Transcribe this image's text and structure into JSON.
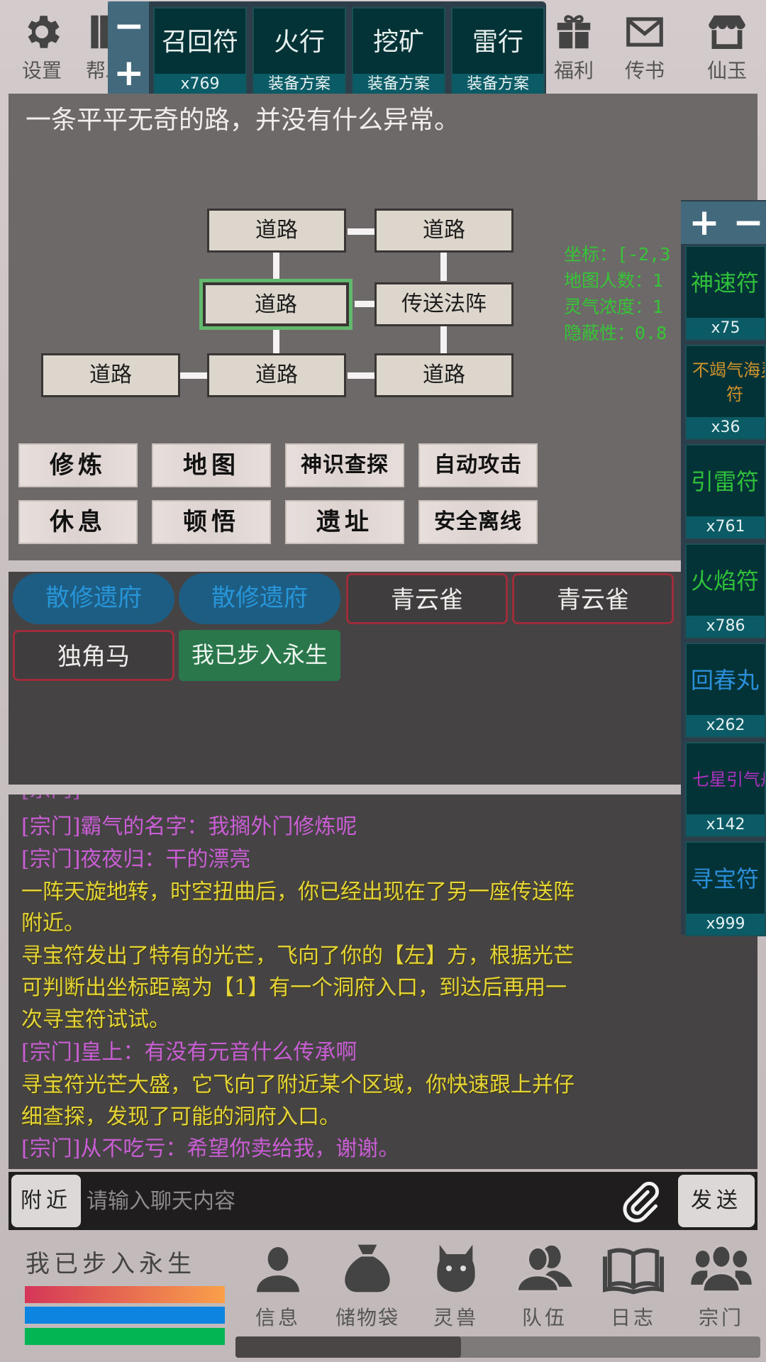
{
  "top_icons": {
    "settings": "设置",
    "help": "帮助",
    "welfare": "福利",
    "mail": "传书",
    "shop": "仙玉"
  },
  "top_quickslots": {
    "zoom_out": "−",
    "zoom_in": "+",
    "slots": [
      {
        "name": "召回符",
        "sub": "x769"
      },
      {
        "name": "火行",
        "sub": "装备方案"
      },
      {
        "name": "挖矿",
        "sub": "装备方案"
      },
      {
        "name": "雷行",
        "sub": "装备方案"
      }
    ]
  },
  "location": {
    "description": "一条平平无奇的路，并没有什么异常。",
    "map_nodes": [
      {
        "id": "n1",
        "label": "道路"
      },
      {
        "id": "n2",
        "label": "道路"
      },
      {
        "id": "n3",
        "label": "道路",
        "current": true
      },
      {
        "id": "n4",
        "label": "传送法阵"
      },
      {
        "id": "n5",
        "label": "道路"
      },
      {
        "id": "n6",
        "label": "道路"
      },
      {
        "id": "n7",
        "label": "道路"
      }
    ],
    "info": {
      "coords": "坐标：[-2,3",
      "map_players": "地图人数：1",
      "spirit_density": "灵气浓度：1",
      "concealment": "隐蔽性：0.8"
    },
    "highlight_color": "#62b86c",
    "info_color": "#36c536"
  },
  "actions": [
    "修炼",
    "地图",
    "神识查探",
    "自动攻击",
    "休息",
    "顿悟",
    "遗址",
    "安全离线"
  ],
  "entities": [
    {
      "label": "散修遗府",
      "type": "blue"
    },
    {
      "label": "散修遗府",
      "type": "blue"
    },
    {
      "label": "青云雀",
      "type": "red"
    },
    {
      "label": "青云雀",
      "type": "red"
    },
    {
      "label": "独角马",
      "type": "red"
    },
    {
      "label": "我已步入永生",
      "type": "green"
    }
  ],
  "chat": {
    "messages": [
      {
        "type": "sect",
        "text": "[宗门]霸气的名字：我搁外门修炼呢"
      },
      {
        "type": "sect",
        "text": "[宗门]夜夜归：干的漂亮"
      },
      {
        "type": "sys",
        "text": "一阵天旋地转，时空扭曲后，你已经出现在了另一座传送阵"
      },
      {
        "type": "sys",
        "text": "附近。"
      },
      {
        "type": "sys",
        "text": "寻宝符发出了特有的光芒，飞向了你的【左】方，根据光芒"
      },
      {
        "type": "sys",
        "text": "可判断出坐标距离为【1】有一个洞府入口，到达后再用一"
      },
      {
        "type": "sys",
        "text": "次寻宝符试试。"
      },
      {
        "type": "sect",
        "text": "[宗门]皇上：有没有元音什么传承啊"
      },
      {
        "type": "sys",
        "text": "寻宝符光芒大盛，它飞向了附近某个区域，你快速跟上并仔"
      },
      {
        "type": "sys",
        "text": "细查探，发现了可能的洞府入口。"
      },
      {
        "type": "sect",
        "text": "[宗门]从不吃亏：希望你卖给我，谢谢。"
      }
    ],
    "channel_button": "附近",
    "input_placeholder": "请输入聊天内容",
    "input_value": "",
    "send_button": "发送",
    "sect_color": "#c95ed4",
    "system_color": "#e4d43a"
  },
  "right_quickslots": {
    "zoom_in": "+",
    "zoom_out": "−",
    "slots": [
      {
        "name": "神速符",
        "count": "x75",
        "color": "#2fbf3a"
      },
      {
        "name": "不竭气海灵符",
        "count": "x36",
        "color": "#d0932b"
      },
      {
        "name": "引雷符",
        "count": "x761",
        "color": "#2fbf3a"
      },
      {
        "name": "火焰符",
        "count": "x786",
        "color": "#2fbf3a"
      },
      {
        "name": "回春丸",
        "count": "x262",
        "color": "#2a8fd8"
      },
      {
        "name": "七星引气丹",
        "count": "x142",
        "color": "#b030c0"
      },
      {
        "name": "寻宝符",
        "count": "x999",
        "color": "#2a8fd8"
      }
    ]
  },
  "player": {
    "name": "我已步入永生",
    "health_fraction": 1.0,
    "mana_fraction": 1.0,
    "stamina_fraction": 1.0,
    "health_colors": [
      "#d43658",
      "#f9a04a"
    ],
    "mana_color": "#0d84df",
    "stamina_color": "#04b553"
  },
  "bottom_nav": [
    {
      "label": "信息",
      "icon": "person-icon"
    },
    {
      "label": "储物袋",
      "icon": "bag-icon"
    },
    {
      "label": "灵兽",
      "icon": "beast-icon"
    },
    {
      "label": "队伍",
      "icon": "team-icon"
    },
    {
      "label": "日志",
      "icon": "book-icon"
    },
    {
      "label": "宗门",
      "icon": "sect-icon"
    }
  ],
  "nav_scroll_fraction": 0.43
}
